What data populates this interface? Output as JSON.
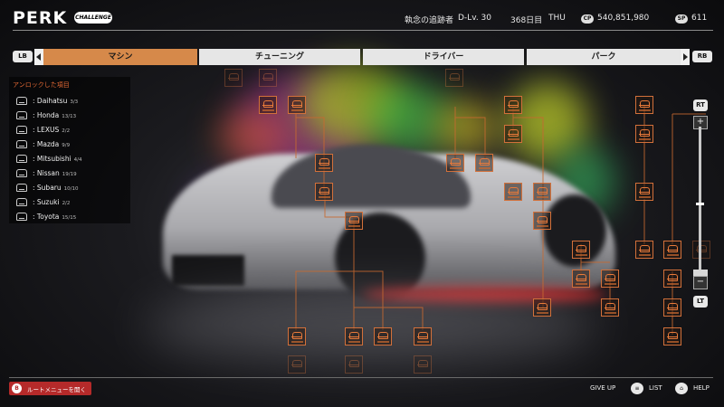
{
  "header": {
    "title": "PERK",
    "badge": "CHALLENGE",
    "rival": "執念の追跡者",
    "driver_level": "D-Lv. 30",
    "day": "368日目",
    "weekday": "THU",
    "cp_icon": "CP",
    "cp_value": "540,851,980",
    "sp_icon": "SP",
    "sp_value": "611"
  },
  "tabs": {
    "left_bumper": "LB",
    "right_bumper": "RB",
    "items": [
      {
        "label": "マシン",
        "active": true
      },
      {
        "label": "チューニング",
        "active": false
      },
      {
        "label": "ドライバー",
        "active": false
      },
      {
        "label": "パーク",
        "active": false
      }
    ]
  },
  "unlock_panel": {
    "header": "アンロックした項目",
    "brands": [
      {
        "name": "Daihatsu",
        "count": "3/3"
      },
      {
        "name": "Honda",
        "count": "13/13"
      },
      {
        "name": "LEXUS",
        "count": "2/2"
      },
      {
        "name": "Mazda",
        "count": "9/9"
      },
      {
        "name": "Mitsubishi",
        "count": "4/4"
      },
      {
        "name": "Nissan",
        "count": "19/19"
      },
      {
        "name": "Subaru",
        "count": "10/10"
      },
      {
        "name": "Suzuki",
        "count": "2/2"
      },
      {
        "name": "Toyota",
        "count": "15/15"
      }
    ]
  },
  "slider": {
    "rt": "RT",
    "lt": "LT",
    "plus": "+",
    "minus": "−"
  },
  "footer": {
    "b_button": "B",
    "root_menu": "ルートメニューを開く",
    "give_up": "GIVE UP",
    "list": "LIST",
    "help": "HELP"
  },
  "colors": {
    "accent": "#d6894a",
    "node_border": "#d2703a",
    "root_button": "#b52a2a",
    "unlock_header": "#e56a35"
  },
  "icons": {
    "brand": "car-icon",
    "node": "car-icon",
    "list": "list-icon",
    "help": "help-icon"
  }
}
